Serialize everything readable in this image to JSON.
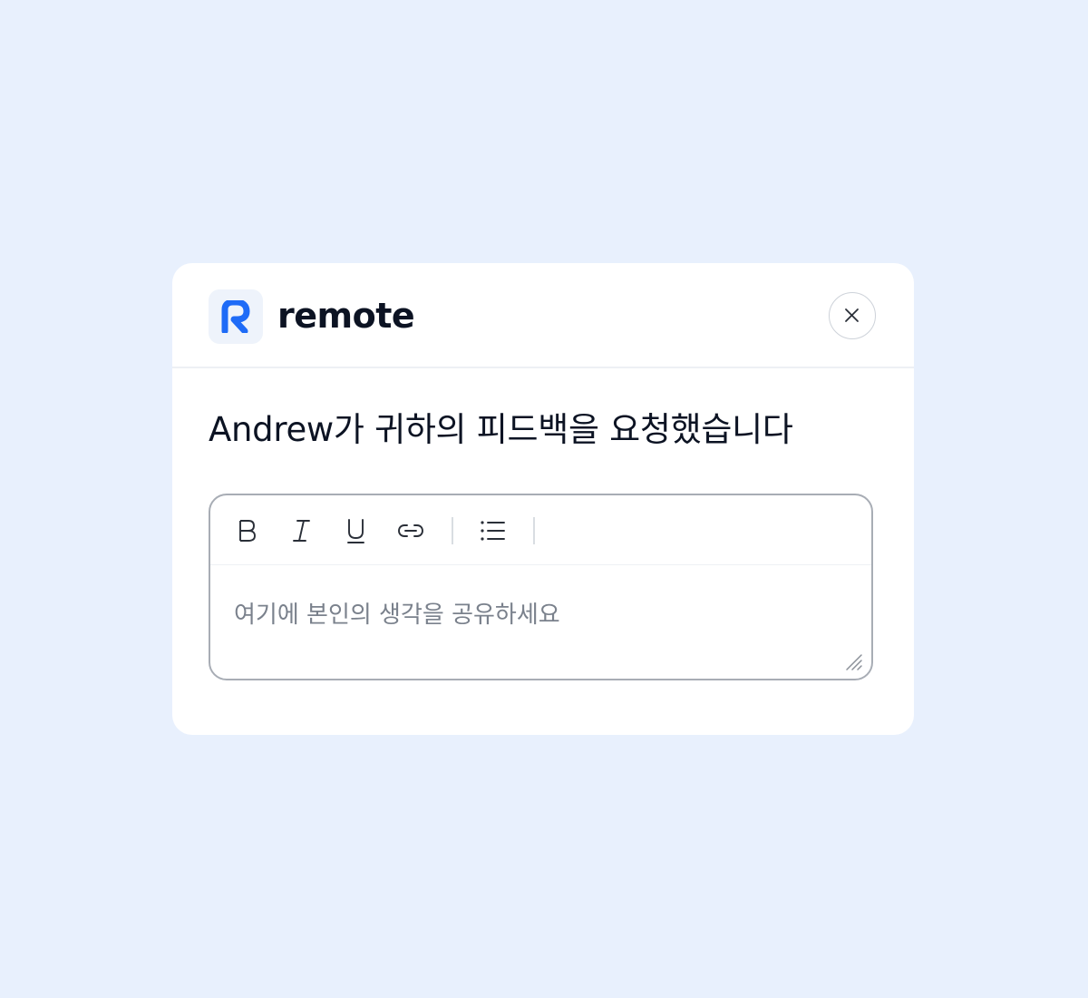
{
  "brand": {
    "name": "remote",
    "logo_icon": "remote-r-logo",
    "accent_color": "#1E6BF7"
  },
  "dialog": {
    "title": "Andrew가 귀하의 피드백을 요청했습니다",
    "close_icon": "close-icon"
  },
  "editor": {
    "placeholder": "여기에 본인의 생각을 공유하세요",
    "value": "",
    "toolbar": [
      {
        "name": "bold",
        "icon": "bold-icon"
      },
      {
        "name": "italic",
        "icon": "italic-icon"
      },
      {
        "name": "underline",
        "icon": "underline-icon"
      },
      {
        "name": "link",
        "icon": "link-icon"
      },
      {
        "name": "bulleted-list",
        "icon": "list-icon"
      }
    ]
  },
  "colors": {
    "page_background": "#E8F0FD",
    "card_background": "#FFFFFF",
    "text_primary": "#0C1323",
    "placeholder_text": "#7A818C"
  }
}
